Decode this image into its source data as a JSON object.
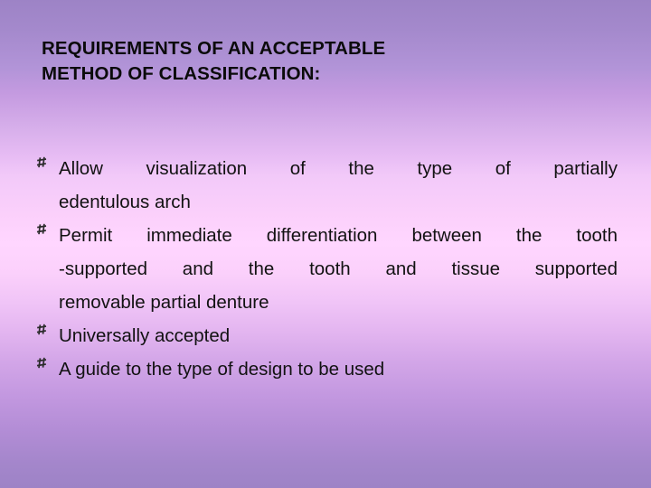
{
  "slide": {
    "title": {
      "line1": "REQUIREMENTS OF AN ACCEPTABLE",
      "line2": "METHOD OF CLASSIFICATION:"
    },
    "bullet_marker_icon": "wingdings-hash-bullet-icon",
    "bullets": [
      {
        "id": "bullet-allow-visualization",
        "justified_lines": [
          "Allow visualization of the type of partially"
        ],
        "plain_lines": [
          "edentulous arch"
        ],
        "full_text": "Allow visualization of the type of partially edentulous arch"
      },
      {
        "id": "bullet-permit-differentiation",
        "justified_lines": [
          "Permit immediate differentiation between the tooth",
          "-supported and the tooth and tissue supported"
        ],
        "plain_lines": [
          "removable partial denture"
        ],
        "full_text": "Permit immediate differentiation between the tooth -supported and the tooth and tissue supported removable partial denture"
      },
      {
        "id": "bullet-universally-accepted",
        "justified_lines": [],
        "plain_lines": [
          "Universally accepted"
        ],
        "full_text": "Universally accepted"
      },
      {
        "id": "bullet-guide-to-design",
        "justified_lines": [],
        "plain_lines": [
          "A guide to the type of design to be used"
        ],
        "full_text": "A guide to the type of design to be used"
      }
    ],
    "colors": {
      "background_top": "#9d83c6",
      "background_middle": "#ffd6ff",
      "background_bottom": "#9d83c6",
      "title_text": "#0b0b0b",
      "body_text": "#121212",
      "bullet_marker": "#2b2b2b"
    }
  }
}
